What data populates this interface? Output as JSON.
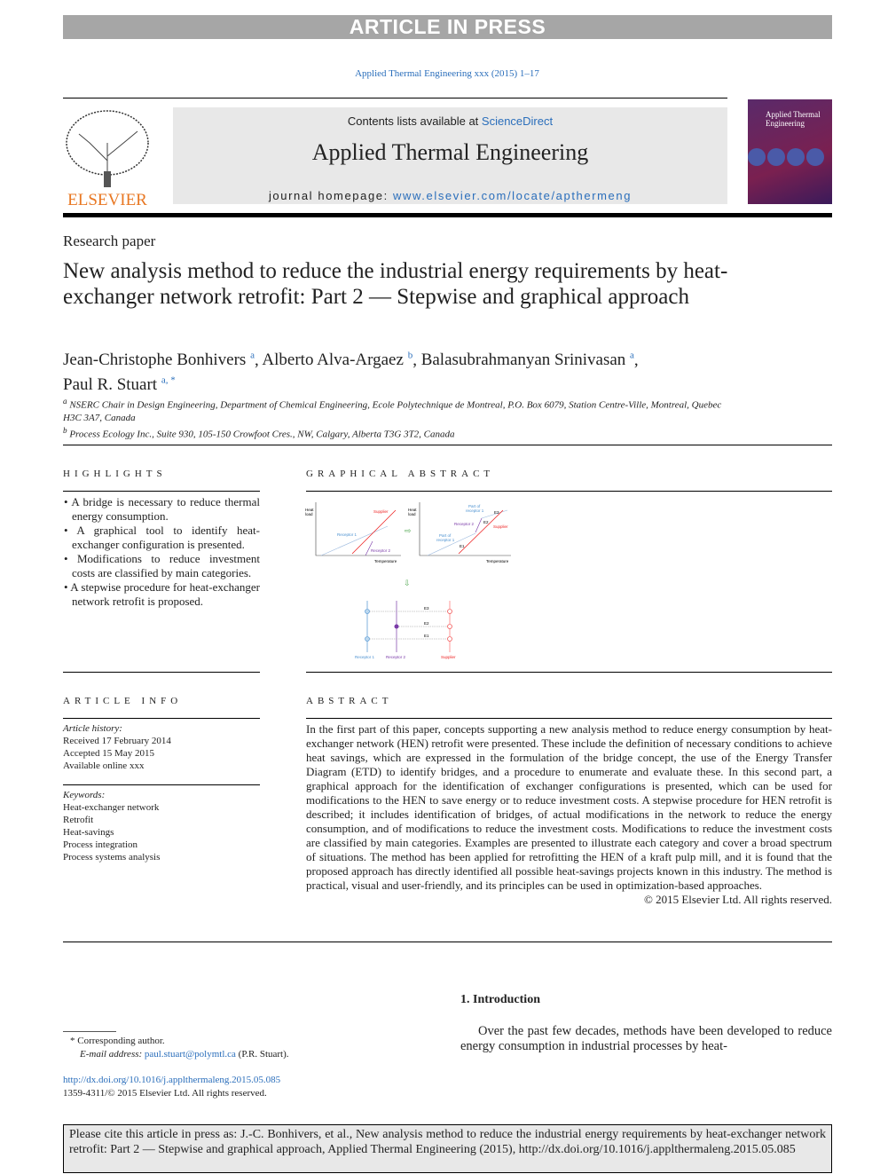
{
  "banner": "ARTICLE IN PRESS",
  "journal_ref": "Applied Thermal Engineering xxx (2015) 1–17",
  "header": {
    "contents_prefix": "Contents lists available at ",
    "contents_link": "ScienceDirect",
    "journal_title": "Applied Thermal Engineering",
    "homepage_prefix": "journal homepage: ",
    "homepage_link": "www.elsevier.com/locate/apthermeng",
    "publisher": "ELSEVIER",
    "cover_title": "Applied Thermal Engineering"
  },
  "article_type": "Research paper",
  "title": "New analysis method to reduce the industrial energy requirements by heat-exchanger network retrofit: Part 2 — Stepwise and graphical approach",
  "authors": [
    {
      "name": "Jean-Christophe Bonhivers",
      "sup": "a"
    },
    {
      "name": "Alberto Alva-Argaez",
      "sup": "b"
    },
    {
      "name": "Balasubrahmanyan Srinivasan",
      "sup": "a"
    },
    {
      "name": "Paul R. Stuart",
      "sup": "a, *"
    }
  ],
  "affiliations": [
    {
      "sup": "a",
      "text": "NSERC Chair in Design Engineering, Department of Chemical Engineering, Ecole Polytechnique de Montreal, P.O. Box 6079, Station Centre-Ville, Montreal, Quebec H3C 3A7, Canada"
    },
    {
      "sup": "b",
      "text": "Process Ecology Inc., Suite 930, 105-150 Crowfoot Cres., NW, Calgary, Alberta T3G 3T2, Canada"
    }
  ],
  "highlights": {
    "heading": "HIGHLIGHTS",
    "items": [
      "A bridge is necessary to reduce thermal energy consumption.",
      "A graphical tool to identify heat-exchanger configuration is presented.",
      "Modifications to reduce investment costs are classified by main categories.",
      "A stepwise procedure for heat-exchanger network retrofit is proposed."
    ]
  },
  "graphical_abstract": {
    "heading": "GRAPHICAL ABSTRACT",
    "y_label_1": "Heat",
    "y_label_2": "load",
    "x_label": "Temperature",
    "supplier": "Supplier",
    "receptor1": "Receptor 1",
    "receptor2": "Receptor 2",
    "part_of_1": "Part of",
    "part_of_2": "receptor 1",
    "e1": "E1",
    "e2": "E2",
    "e3": "E3"
  },
  "article_info": {
    "heading": "ARTICLE INFO",
    "history_label": "Article history:",
    "history": [
      "Received 17 February 2014",
      "Accepted 15 May 2015",
      "Available online xxx"
    ],
    "keywords_label": "Keywords:",
    "keywords": [
      "Heat-exchanger network",
      "Retrofit",
      "Heat-savings",
      "Process integration",
      "Process systems analysis"
    ]
  },
  "abstract": {
    "heading": "ABSTRACT",
    "text": "In the first part of this paper, concepts supporting a new analysis method to reduce energy consumption by heat-exchanger network (HEN) retrofit were presented. These include the definition of necessary conditions to achieve heat savings, which are expressed in the formulation of the bridge concept, the use of the Energy Transfer Diagram (ETD) to identify bridges, and a procedure to enumerate and evaluate these. In this second part, a graphical approach for the identification of exchanger configurations is presented, which can be used for modifications to the HEN to save energy or to reduce investment costs. A stepwise procedure for HEN retrofit is described; it includes identification of bridges, of actual modifications in the network to reduce the energy consumption, and of modifications to reduce the investment costs. Modifications to reduce the investment costs are classified by main categories. Examples are presented to illustrate each category and cover a broad spectrum of situations. The method has been applied for retrofitting the HEN of a kraft pulp mill, and it is found that the proposed approach has directly identified all possible heat-savings projects known in this industry. The method is practical, visual and user-friendly, and its principles can be used in optimization-based approaches.",
    "copyright": "© 2015 Elsevier Ltd. All rights reserved."
  },
  "introduction": {
    "heading": "1.  Introduction",
    "text": "Over the past few decades, methods have been developed to reduce energy consumption in industrial processes by heat-"
  },
  "footnote": {
    "corresponding": "Corresponding author.",
    "email_label": "E-mail address: ",
    "email": "paul.stuart@polymtl.ca",
    "email_suffix": " (P.R. Stuart)."
  },
  "doi": "http://dx.doi.org/10.1016/j.applthermaleng.2015.05.085",
  "issn": "1359-4311/© 2015 Elsevier Ltd. All rights reserved.",
  "cite_box": "Please cite this article in press as: J.-C. Bonhivers, et al., New analysis method to reduce the industrial energy requirements by heat-exchanger network retrofit: Part 2 — Stepwise and graphical approach, Applied Thermal Engineering (2015), http://dx.doi.org/10.1016/j.applthermaleng.2015.05.085",
  "colors": {
    "link": "#2a6ebb",
    "supplier": "#ee2222",
    "receptor1": "#4a90d0",
    "receptor2": "#7a3aa8",
    "banner": "#a6a6a6"
  }
}
